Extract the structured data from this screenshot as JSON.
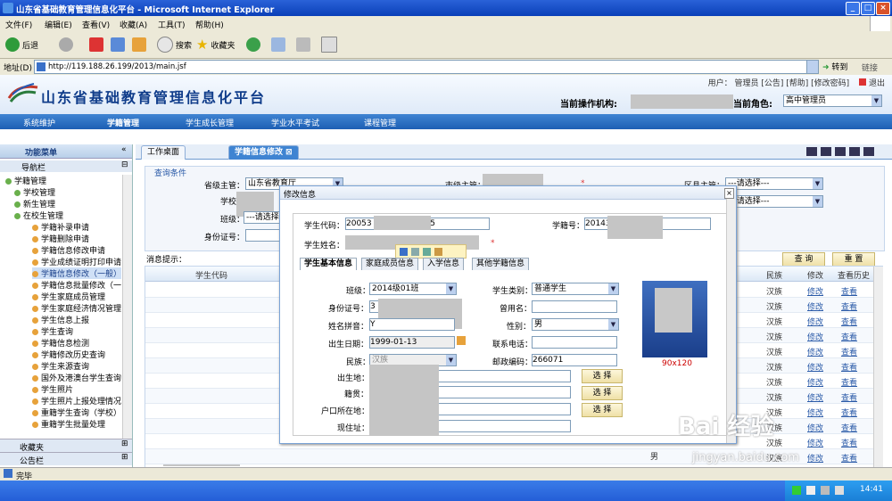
{
  "window": {
    "title": "山东省基础教育管理信息化平台 - Microsoft Internet Explorer",
    "menu": [
      "文件(F)",
      "编辑(E)",
      "查看(V)",
      "收藏(A)",
      "工具(T)",
      "帮助(H)"
    ],
    "toolbar": {
      "back": "后退",
      "search": "搜索",
      "favorites": "收藏夹"
    },
    "address_label": "地址(D)",
    "url": "http://119.188.26.199/2013/main.jsf",
    "go": "转到",
    "links": "链接"
  },
  "app": {
    "title": "山东省基础教育管理信息化平台",
    "top_links": "用户： 管理员    [公告] [帮助] [修改密码]",
    "exit": "退出",
    "current_org_label": "当前操作机构:",
    "current_role_label": "当前角色:",
    "role_value": "高中管理员",
    "nav": [
      "系统维护",
      "学籍管理",
      "学生成长管理",
      "学业水平考试",
      "课程管理"
    ]
  },
  "sidebar": {
    "title": "功能菜单",
    "nav_label": "导航栏",
    "tree": [
      "学籍管理",
      "学校管理",
      "新生管理",
      "在校生管理",
      "学籍补录申请",
      "学籍删除申请",
      "学籍信息修改申请",
      "学业成绩证明打印申请",
      "学籍信息修改（一般）",
      "学籍信息批量修改（一般）",
      "学生家庭成员管理",
      "学生家庭经济情况管理",
      "学生信息上报",
      "学生查询",
      "学籍信息检测",
      "学籍修改历史查询",
      "学生来源查询",
      "国外及港澳台学生查询",
      "学生照片",
      "学生照片上报处理情况",
      "重籍学生查询（学校）",
      "重籍学生批量处理"
    ],
    "favorites": "收藏夹",
    "notice": "公告栏"
  },
  "tabs": [
    "工作桌面",
    "学籍信息修改"
  ],
  "query": {
    "section": "查询条件",
    "province_label": "省级主管：",
    "province_value": "山东省教育厅",
    "city_label": "市级主管：",
    "district_label": "区县主管：",
    "district_value": "---请选择---",
    "school_label": "学校：",
    "school_value": "---请选择---",
    "class_label": "班级：",
    "class_value": "---请选择",
    "id_label": "身份证号：",
    "message_label": "消息提示：",
    "query_btn": "查 询",
    "reset_btn": "重 置"
  },
  "table": {
    "headers": [
      "学生代码",
      "民族",
      "修改",
      "查看历史"
    ],
    "rows": [
      [
        "汉族",
        "修改",
        "查看"
      ],
      [
        "汉族",
        "修改",
        "查看"
      ],
      [
        "汉族",
        "修改",
        "查看"
      ],
      [
        "汉族",
        "修改",
        "查看"
      ],
      [
        "汉族",
        "修改",
        "查看"
      ],
      [
        "汉族",
        "修改",
        "查看"
      ],
      [
        "汉族",
        "修改",
        "查看"
      ],
      [
        "汉族",
        "修改",
        "查看"
      ],
      [
        "汉族",
        "修改",
        "查看"
      ],
      [
        "汉族",
        "修改",
        "查看"
      ],
      [
        "汉族",
        "修改",
        "查看"
      ],
      [
        "汉族",
        "修改",
        "查看"
      ]
    ],
    "bottom_row_gender": "男"
  },
  "modal": {
    "title": "修改信息",
    "student_code_label": "学生代码：",
    "student_code_value": "20053",
    "student_code_suffix": "5",
    "register_no_label": "学籍号：",
    "register_no_value": "20143",
    "name_label": "学生姓名：",
    "tabs": [
      "学生基本信息",
      "家庭成员信息",
      "入学信息",
      "其他学籍信息"
    ],
    "fields": {
      "class_label": "班级：",
      "class_value": "2014级01班",
      "category_label": "学生类别：",
      "category_value": "普通学生",
      "id_label": "身份证号：",
      "id_value": "3",
      "former_name_label": "曾用名：",
      "pinyin_label": "姓名拼音：",
      "pinyin_value": "Y",
      "gender_label": "性别：",
      "gender_value": "男",
      "birth_label": "出生日期：",
      "birth_value": "1999-01-13",
      "phone_label": "联系电话：",
      "ethnic_label": "民族：",
      "ethnic_value": "汉族",
      "postcode_label": "邮政编码：",
      "postcode_value": "266071",
      "birthplace_label": "出生地：",
      "native_label": "籍贯：",
      "hukou_label": "户口所在地：",
      "address_label": "现住址："
    },
    "choose_btn": "选 择",
    "photo_caption": "90x120"
  },
  "status": {
    "text": "完毕",
    "time": "14:41"
  },
  "watermark": {
    "brand": "Bai 经验",
    "url": "jingyan.baidu.com"
  }
}
